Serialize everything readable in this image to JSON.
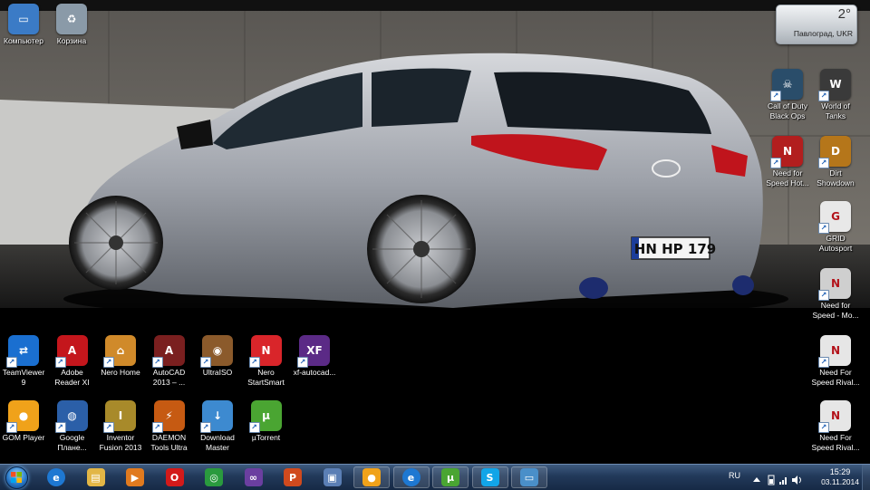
{
  "desktop": {
    "left_icons": [
      {
        "id": "computer",
        "label": "Компьютер",
        "icon": "computer-icon",
        "color": "#3b7bc6"
      },
      {
        "id": "recycle-bin",
        "label": "Корзина",
        "icon": "recycle-bin-icon",
        "color": "#8a9aa8"
      }
    ],
    "row1": [
      {
        "id": "teamviewer",
        "label": "TeamViewer\n9",
        "icon": "teamviewer-icon",
        "color": "#1a6fd0",
        "glyph": "⇄"
      },
      {
        "id": "adobe-reader",
        "label": "Adobe\nReader XI",
        "icon": "adobe-reader-icon",
        "color": "#c4161c",
        "glyph": "A"
      },
      {
        "id": "nero-home",
        "label": "Nero Home",
        "icon": "nero-home-icon",
        "color": "#d08a2a",
        "glyph": "⌂"
      },
      {
        "id": "autocad",
        "label": "AutoCAD\n2013 – ...",
        "icon": "autocad-icon",
        "color": "#7a1f1f",
        "glyph": "A"
      },
      {
        "id": "ultraiso",
        "label": "UltraISO",
        "icon": "ultraiso-icon",
        "color": "#8b5a2b",
        "glyph": "◉"
      },
      {
        "id": "nero-startsmart",
        "label": "Nero\nStartSmart",
        "icon": "nero-startsmart-icon",
        "color": "#d9252a",
        "glyph": "N"
      },
      {
        "id": "xf-autocad",
        "label": "xf-autocad...",
        "icon": "xf-autocad-icon",
        "color": "#5b2a86",
        "glyph": "XF"
      }
    ],
    "row2": [
      {
        "id": "gom-player",
        "label": "GOM Player",
        "icon": "gom-player-icon",
        "color": "#f0a21a",
        "glyph": "●"
      },
      {
        "id": "google-earth",
        "label": "Google\nПлане...",
        "icon": "google-earth-icon",
        "color": "#2b5fa8",
        "glyph": "◍"
      },
      {
        "id": "inventor",
        "label": "Inventor\nFusion 2013",
        "icon": "inventor-fusion-icon",
        "color": "#a88a2a",
        "glyph": "I"
      },
      {
        "id": "daemon-tools",
        "label": "DAEMON\nTools Ultra",
        "icon": "daemon-tools-icon",
        "color": "#c65a12",
        "glyph": "⚡"
      },
      {
        "id": "download-master",
        "label": "Download\nMaster",
        "icon": "download-master-icon",
        "color": "#3d8ad0",
        "glyph": "↓"
      },
      {
        "id": "utorrent",
        "label": "µTorrent",
        "icon": "utorrent-icon",
        "color": "#4aa532",
        "glyph": "µ"
      }
    ],
    "right_icons": [
      {
        "id": "cod-black-ops",
        "label": "Call of Duty\nBlack Ops",
        "icon": "call-of-duty-icon",
        "color": "#2a4d6a",
        "glyph": "☠"
      },
      {
        "id": "world-of-tanks",
        "label": "World of\nTanks",
        "icon": "world-of-tanks-icon",
        "color": "#3a3a3a",
        "glyph": "W"
      },
      {
        "id": "nfs-hot-pursuit",
        "label": "Need for\nSpeed Hot...",
        "icon": "nfs-hot-pursuit-icon",
        "color": "#b21e1e",
        "glyph": "N"
      },
      {
        "id": "dirt-showdown",
        "label": "Dirt\nShowdown",
        "icon": "dirt-showdown-icon",
        "color": "#b5761a",
        "glyph": "D"
      },
      {
        "id": "grid-autosport",
        "label": "GRID\nAutosport",
        "icon": "grid-autosport-icon",
        "color": "#e8e8e8",
        "glyph": "G"
      },
      {
        "id": "nfs-most-wanted",
        "label": "Need for\nSpeed - Mo...",
        "icon": "nfs-most-wanted-icon",
        "color": "#cfcfcf",
        "glyph": "N"
      },
      {
        "id": "nfs-rivals-1",
        "label": "Need For\nSpeed Rival...",
        "icon": "nfs-rivals-icon",
        "color": "#e6e6e6",
        "glyph": "N"
      },
      {
        "id": "nfs-rivals-2",
        "label": "Need For\nSpeed Rival...",
        "icon": "nfs-rivals-icon",
        "color": "#e6e6e6",
        "glyph": "N"
      }
    ],
    "wallpaper": {
      "plate": "HN HP 179"
    }
  },
  "weather": {
    "temp": "2°",
    "city": "Павлоград, UKR"
  },
  "taskbar": {
    "items": [
      {
        "id": "ie",
        "icon": "internet-explorer-icon",
        "color": "#1e78d2",
        "glyph": "e"
      },
      {
        "id": "explorer",
        "icon": "folder-icon",
        "color": "#e2b646",
        "glyph": "▤"
      },
      {
        "id": "media-player",
        "icon": "media-player-icon",
        "color": "#e07a1f",
        "glyph": "▶"
      },
      {
        "id": "opera",
        "icon": "opera-icon",
        "color": "#d31a1a",
        "glyph": "O"
      },
      {
        "id": "chrome",
        "icon": "chrome-icon",
        "color": "#2a9a3e",
        "glyph": "◎"
      },
      {
        "id": "visual-studio",
        "icon": "visual-studio-icon",
        "color": "#6b3fa0",
        "glyph": "∞"
      },
      {
        "id": "powerpoint",
        "icon": "powerpoint-icon",
        "color": "#d04a1e",
        "glyph": "P"
      },
      {
        "id": "app-generic",
        "icon": "app-icon",
        "color": "#5b7fb5",
        "glyph": "▣"
      },
      {
        "id": "gom-player-tb",
        "icon": "gom-player-icon",
        "color": "#f0a21a",
        "glyph": "●"
      },
      {
        "id": "ie-2",
        "icon": "internet-explorer-icon",
        "color": "#1e78d2",
        "glyph": "e"
      },
      {
        "id": "utorrent-tb",
        "icon": "utorrent-icon",
        "color": "#4aa532",
        "glyph": "µ"
      },
      {
        "id": "skype",
        "icon": "skype-icon",
        "color": "#12a5e8",
        "glyph": "S"
      },
      {
        "id": "photo-viewer",
        "icon": "photo-viewer-icon",
        "color": "#4a8fc9",
        "glyph": "▭"
      }
    ],
    "tray": {
      "language": "RU",
      "time": "15:29",
      "date": "03.11.2014"
    }
  }
}
